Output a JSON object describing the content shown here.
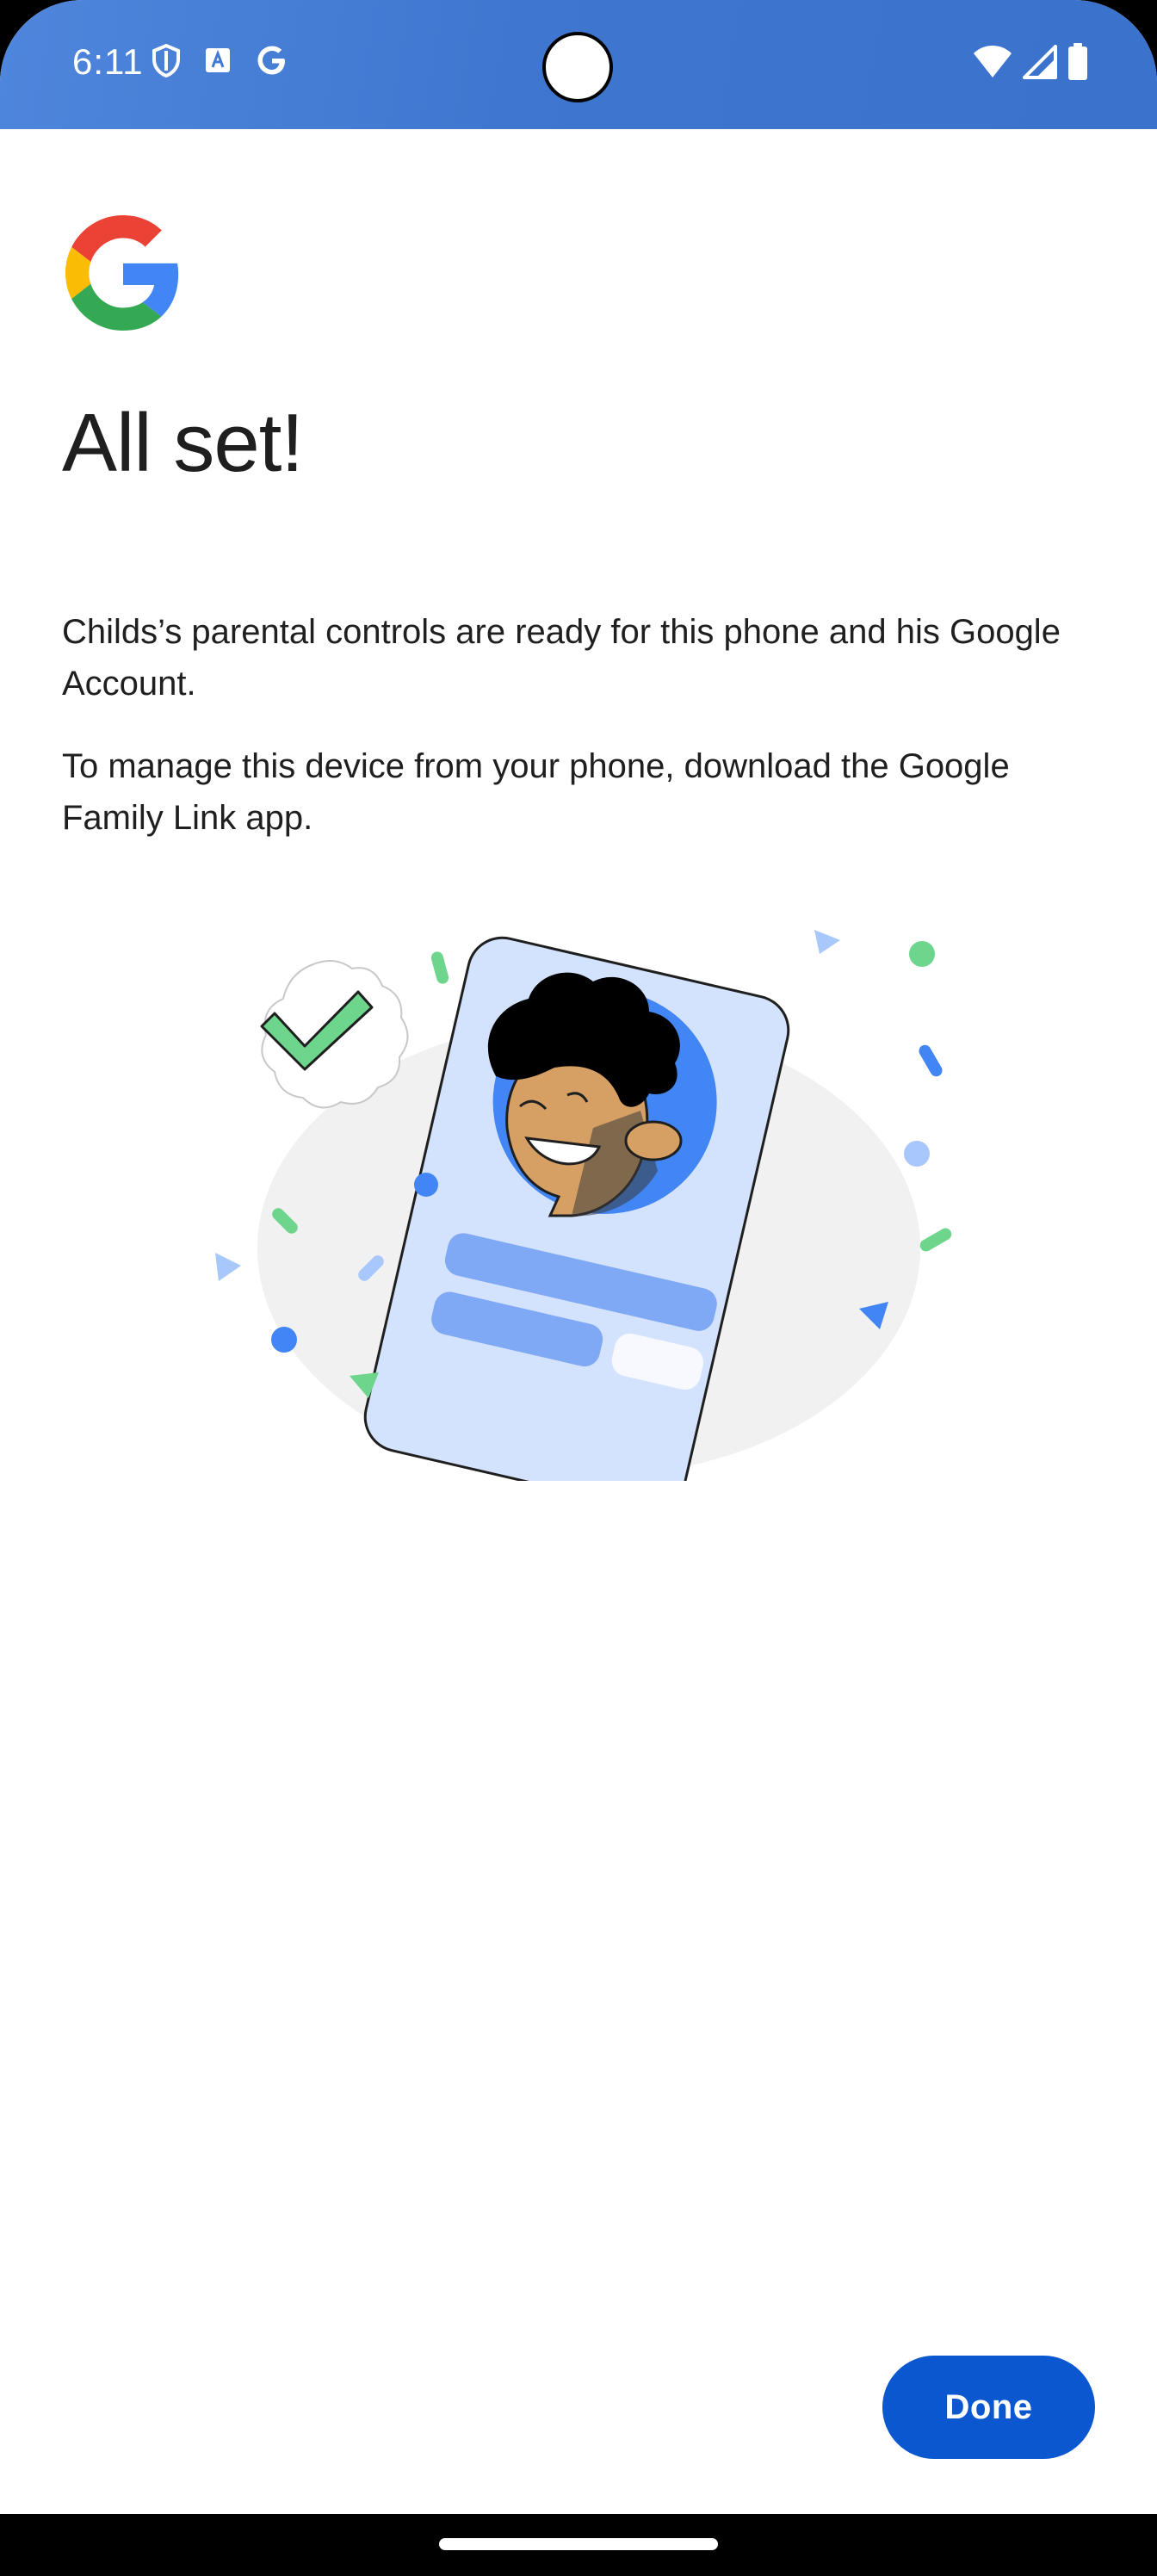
{
  "status_bar": {
    "time": "6:11",
    "left_icons": [
      "shield-icon",
      "translate-icon",
      "google-g-icon"
    ],
    "right_icons": [
      "wifi-icon",
      "cell-signal-icon",
      "battery-icon"
    ],
    "background": "#4179d3"
  },
  "header": {
    "logo": "google-logo",
    "title": "All set!"
  },
  "content": {
    "paragraphs": [
      "Childs’s parental controls are ready for this phone and his Google Account.",
      "To manage this device from your phone, download the Google Family Link app."
    ],
    "illustration": "child-phone-checkmark-illustration"
  },
  "actions": {
    "done_label": "Done"
  },
  "colors": {
    "primary": "#0b57d0",
    "text": "#1f1f1f",
    "green": "#6dd58c",
    "light_blue": "#d3e3fd",
    "mid_blue": "#7fa8f5"
  }
}
